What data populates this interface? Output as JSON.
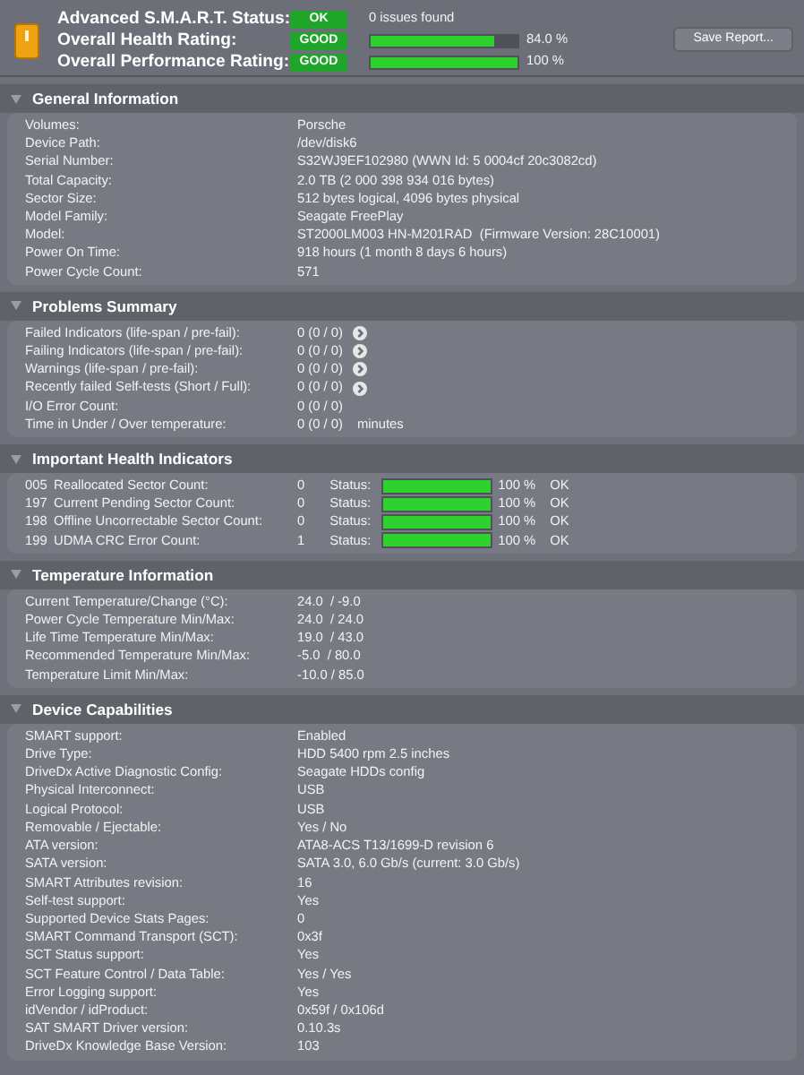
{
  "summary": {
    "rows": [
      {
        "label": "Advanced S.M.A.R.T. Status:",
        "badge": "OK",
        "text": "0 issues found"
      },
      {
        "label": "Overall Health Rating:",
        "badge": "GOOD",
        "level": 0.84,
        "reading": "84.0 %"
      },
      {
        "label": "Overall Performance Rating:",
        "badge": "GOOD",
        "level": 1.0,
        "reading": "100 %"
      }
    ],
    "save_button": "Save Report..."
  },
  "sections": [
    {
      "title": "General Information",
      "expanded": true,
      "kind": "plain",
      "rows": [
        {
          "label": "Volumes:",
          "value": "Porsche"
        },
        {
          "label": "Device Path:",
          "value": "/dev/disk6"
        },
        {
          "label": "Serial Number:",
          "value": "S32WJ9EF102980 (WWN Id: 5 0004cf 20c3082cd)"
        },
        {
          "label": "Total Capacity:",
          "value": "2.0 TB (2 000 398 934 016 bytes)"
        },
        {
          "label": "Sector Size:",
          "value": "512 bytes logical, 4096 bytes physical"
        },
        {
          "label": "Model Family:",
          "value": "Seagate FreePlay"
        },
        {
          "label": "Model:",
          "value": "ST2000LM003 HN-M201RAD  (Firmware Version: 28C10001)"
        },
        {
          "label": "Power On Time:",
          "value": "918 hours (1 month 8 days 6 hours)"
        },
        {
          "label": "Power Cycle Count:",
          "value": "571"
        }
      ]
    },
    {
      "title": "Problems Summary",
      "expanded": true,
      "kind": "problems",
      "rows": [
        {
          "label": "Failed Indicators (life-span / pre-fail):",
          "value": "0 (0 / 0)",
          "detail_button": true
        },
        {
          "label": "Failing Indicators (life-span / pre-fail):",
          "value": "0 (0 / 0)",
          "detail_button": true
        },
        {
          "label": "Warnings (life-span / pre-fail):",
          "value": "0 (0 / 0)",
          "detail_button": true
        },
        {
          "label": "Recently failed Self-tests (Short / Full):",
          "value": "0 (0 / 0)",
          "detail_button": true
        },
        {
          "label": "I/O Error Count:",
          "value": "0 (0 / 0)",
          "detail_button": false
        },
        {
          "label": "Time in Under / Over temperature:",
          "value": "0 (0 / 0)",
          "detail_button": false,
          "unit": "minutes"
        }
      ]
    },
    {
      "title": "Important Health Indicators",
      "expanded": true,
      "kind": "health",
      "rows": [
        {
          "id": "005",
          "label": "Reallocated Sector Count:",
          "value": "0",
          "status_label": "Status:",
          "level": 1.0,
          "reading": "100 %",
          "status": "OK"
        },
        {
          "id": "197",
          "label": "Current Pending Sector Count:",
          "value": "0",
          "status_label": "Status:",
          "level": 1.0,
          "reading": "100 %",
          "status": "OK"
        },
        {
          "id": "198",
          "label": "Offline Uncorrectable Sector Count:",
          "value": "0",
          "status_label": "Status:",
          "level": 1.0,
          "reading": "100 %",
          "status": "OK"
        },
        {
          "id": "199",
          "label": "UDMA CRC Error Count:",
          "value": "1",
          "status_label": "Status:",
          "level": 1.0,
          "reading": "100 %",
          "status": "OK"
        }
      ]
    },
    {
      "title": "Temperature Information",
      "expanded": true,
      "kind": "plain",
      "rows": [
        {
          "label": "Current Temperature/Change (°C):",
          "value": "24.0  / -9.0"
        },
        {
          "label": "Power Cycle Temperature Min/Max:",
          "value": "24.0  / 24.0"
        },
        {
          "label": "Life Time Temperature Min/Max:",
          "value": "19.0  / 43.0"
        },
        {
          "label": "Recommended Temperature Min/Max:",
          "value": "-5.0  / 80.0"
        },
        {
          "label": "Temperature Limit Min/Max:",
          "value": "-10.0 / 85.0"
        }
      ]
    },
    {
      "title": "Device Capabilities",
      "expanded": true,
      "kind": "plain",
      "rows": [
        {
          "label": "SMART support:",
          "value": "Enabled"
        },
        {
          "label": "Drive Type:",
          "value": "HDD 5400 rpm 2.5 inches"
        },
        {
          "label": "DriveDx Active Diagnostic Config:",
          "value": "Seagate HDDs config"
        },
        {
          "label": "Physical Interconnect:",
          "value": "USB"
        },
        {
          "label": "Logical Protocol:",
          "value": "USB"
        },
        {
          "label": "Removable / Ejectable:",
          "value": "Yes / No"
        },
        {
          "label": "ATA version:",
          "value": "ATA8-ACS T13/1699-D revision 6"
        },
        {
          "label": "SATA version:",
          "value": "SATA 3.0, 6.0 Gb/s (current: 3.0 Gb/s)"
        },
        {
          "label": "SMART Attributes revision:",
          "value": "16"
        },
        {
          "label": "Self-test support:",
          "value": "Yes"
        },
        {
          "label": "Supported Device Stats Pages:",
          "value": "0"
        },
        {
          "label": "SMART Command Transport (SCT):",
          "value": "0x3f"
        },
        {
          "label": "SCT Status support:",
          "value": "Yes"
        },
        {
          "label": "SCT Feature Control / Data Table:",
          "value": "Yes / Yes"
        },
        {
          "label": "Error Logging support:",
          "value": "Yes"
        },
        {
          "label": "idVendor / idProduct:",
          "value": "0x59f / 0x106d"
        },
        {
          "label": "SAT SMART Driver version:",
          "value": "0.10.3s"
        },
        {
          "label": "DriveDx Knowledge Base Version:",
          "value": "103"
        }
      ]
    }
  ]
}
